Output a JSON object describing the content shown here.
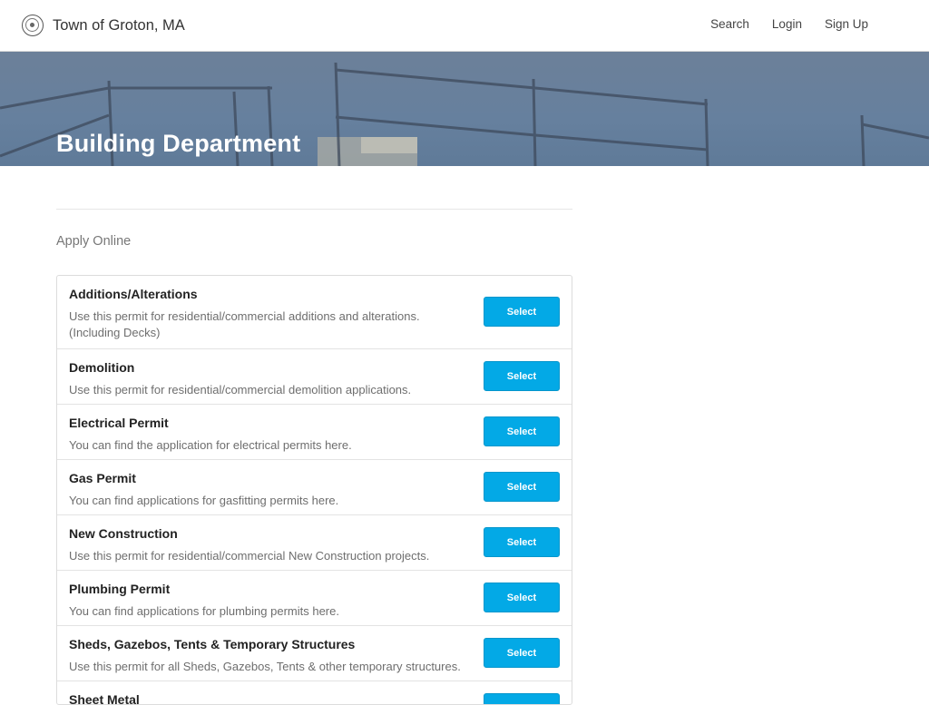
{
  "header": {
    "site_name": "Town of Groton, MA",
    "seal_icon": "town-seal-icon",
    "nav": {
      "search": "Search",
      "login": "Login",
      "signup": "Sign Up"
    }
  },
  "hero": {
    "title": "Building Department"
  },
  "section": {
    "label": "Apply Online"
  },
  "colors": {
    "button": "#03a9e6",
    "hero": "#66809e"
  },
  "permits": [
    {
      "title": "Additions/Alterations",
      "description": "Use this permit for residential/commercial additions and alterations. (Including Decks)",
      "button": "Select"
    },
    {
      "title": "Demolition",
      "description": "Use this permit for residential/commercial demolition applications.",
      "button": "Select"
    },
    {
      "title": "Electrical Permit",
      "description": "You can find the application for electrical permits here.",
      "button": "Select"
    },
    {
      "title": "Gas Permit",
      "description": "You can find applications for gasfitting permits here.",
      "button": "Select"
    },
    {
      "title": "New Construction",
      "description": "Use this permit for residential/commercial New Construction projects.",
      "button": "Select"
    },
    {
      "title": "Plumbing Permit",
      "description": "You can find applications for plumbing permits here.",
      "button": "Select"
    },
    {
      "title": "Sheds, Gazebos, Tents & Temporary Structures",
      "description": "Use this permit for all Sheds, Gazebos, Tents & other temporary structures.",
      "button": "Select"
    },
    {
      "title": "Sheet Metal",
      "description": "",
      "button": "Select"
    }
  ]
}
